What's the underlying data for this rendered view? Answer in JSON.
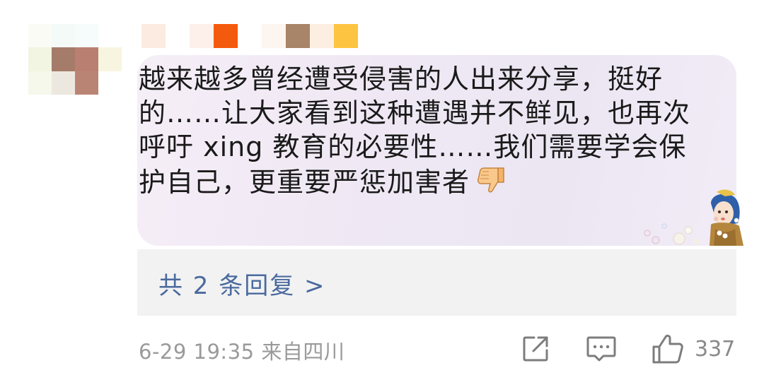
{
  "comment": {
    "lines": [
      "越来越多曾经遭受侵害的人出来分享，挺好",
      "的……让大家看到这种遭遇并不鲜见，也再次",
      "呼吁 xing 教育的必要性……我们需要学会保",
      "护自己，更重要严惩加害者"
    ],
    "emoji": "thumbs-down"
  },
  "replies": {
    "label": "共 2 条回复 >"
  },
  "footer": {
    "meta": "6-29 19:35 来自四川",
    "like_count": "337"
  },
  "icons": {
    "share": "share-icon",
    "comment": "comment-icon",
    "like": "thumbs-up-icon"
  },
  "colors": {
    "link": "#4a6a9d",
    "meta": "#9a9a9a",
    "bubble": "#efe8f4"
  }
}
